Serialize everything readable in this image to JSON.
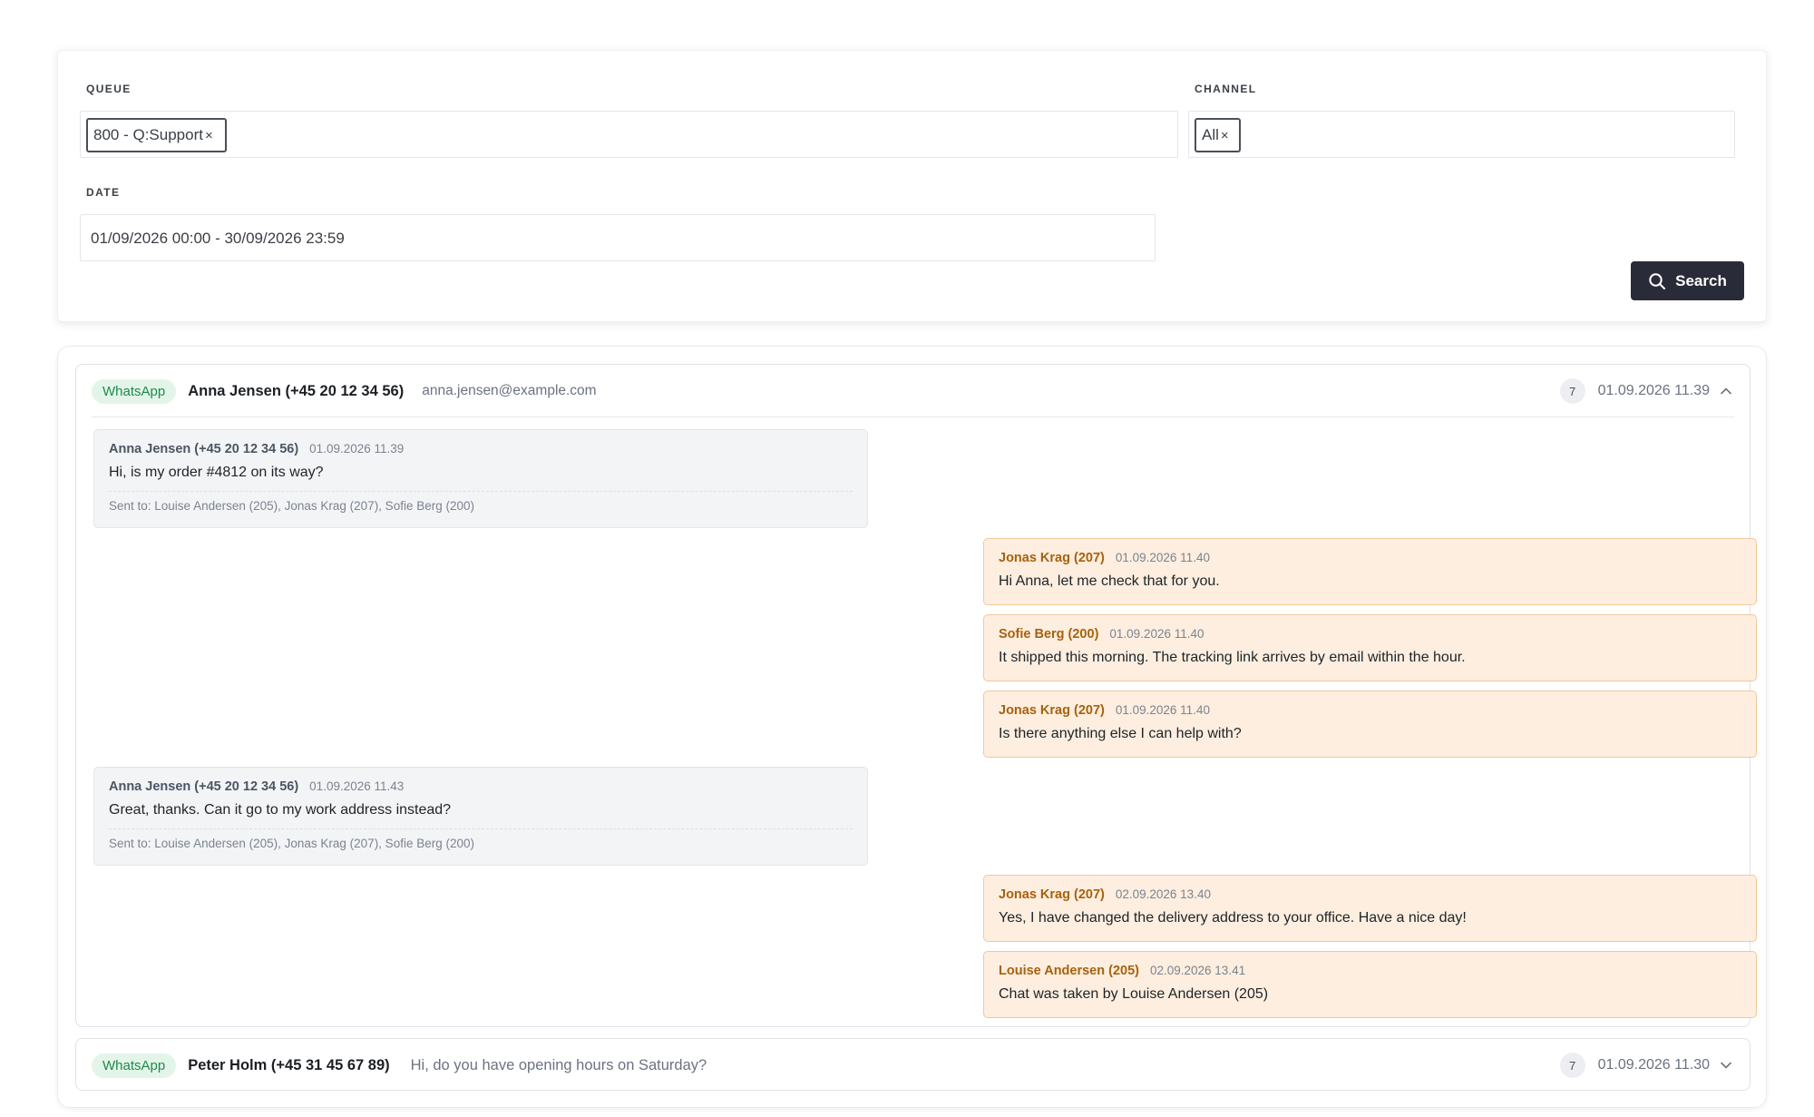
{
  "filters": {
    "queue_label": "QUEUE",
    "queue_chip": "800 - Q:Support",
    "channel_label": "CHANNEL",
    "channel_chip": "All",
    "chip_remove": "×",
    "date_label": "DATE",
    "date_value": "01/09/2026 00:00 - 30/09/2026 23:59",
    "search_label": "Search"
  },
  "conversations": [
    {
      "channel": "WhatsApp",
      "contact": "Anna Jensen (+45 20 12 34 56)",
      "email": "anna.jensen@example.com",
      "count": "7",
      "date": "01.09.2026 11.39",
      "expanded": true,
      "messages": [
        {
          "author": "Anna Jensen (+45 20 12 34 56)",
          "time": "01.09.2026 11.39",
          "text": "Hi, is my order #4812 on its way?",
          "sent_to": "Sent to: Louise Andersen (205), Jonas Krag (207), Sofie Berg (200)"
        },
        {
          "author": "Jonas Krag (207)",
          "time": "01.09.2026 11.40",
          "text": "Hi Anna, let me check that for you."
        },
        {
          "author": "Sofie Berg (200)",
          "time": "01.09.2026 11.40",
          "text": "It shipped this morning. The tracking link arrives by email within the hour."
        },
        {
          "author": "Jonas Krag (207)",
          "time": "01.09.2026 11.40",
          "text": "Is there anything else I can help with?"
        },
        {
          "author": "Anna Jensen (+45 20 12 34 56)",
          "time": "01.09.2026 11.43",
          "text": "Great, thanks. Can it go to my work address instead?",
          "sent_to": "Sent to: Louise Andersen (205), Jonas Krag (207), Sofie Berg (200)"
        },
        {
          "author": "Jonas Krag (207)",
          "time": "02.09.2026 13.40",
          "text": "Yes, I have changed the delivery address to your office. Have a nice day!"
        },
        {
          "author": "Louise Andersen (205)",
          "time": "02.09.2026 13.41",
          "text": "Chat was taken by Louise Andersen (205)"
        }
      ]
    },
    {
      "channel": "WhatsApp",
      "contact": "Peter Holm (+45 31 45 67 89)",
      "preview": "Hi, do you have opening hours on Saturday?",
      "count": "7",
      "date": "01.09.2026 11.30",
      "expanded": false
    }
  ],
  "colors": {
    "primary_button": "#2a2b38",
    "whatsapp_badge_bg": "#e3f5e9",
    "whatsapp_badge_text": "#1f8a4c",
    "agent_bubble_bg": "#fdeedf",
    "agent_bubble_border": "#f3c79c",
    "agent_name": "#a6620f",
    "customer_bubble_bg": "#f3f4f6"
  },
  "icons": {
    "search": "search-icon",
    "expanded": "chevron-up-icon",
    "collapsed": "chevron-down-icon"
  }
}
